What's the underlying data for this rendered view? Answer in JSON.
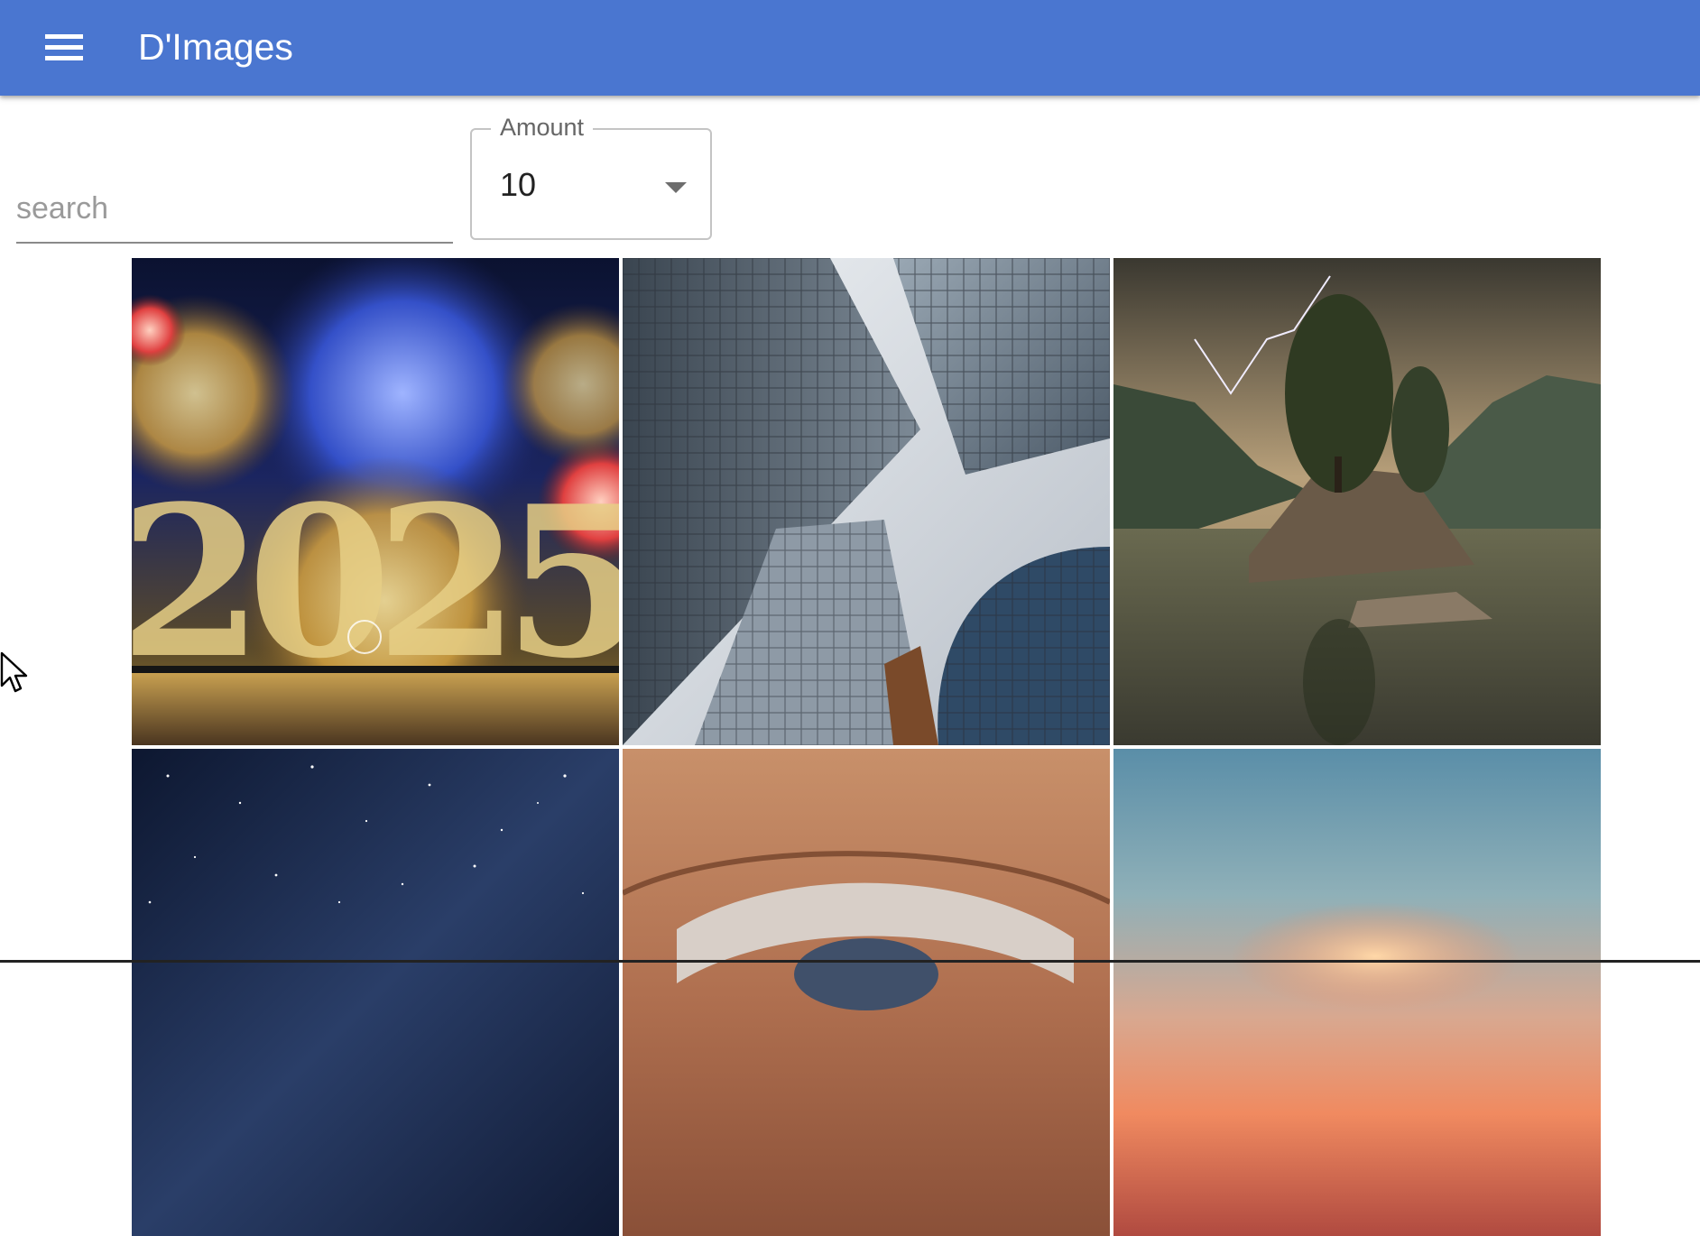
{
  "app": {
    "title": "D'Images",
    "brand_color": "#4a76d0",
    "menu_icon": "hamburger-menu-icon"
  },
  "filters": {
    "search_placeholder": "search",
    "search_value": "",
    "amount_label": "Amount",
    "amount_value": "10"
  },
  "images": [
    {
      "subject": "fireworks-2025"
    },
    {
      "subject": "skyscrapers-looking-up"
    },
    {
      "subject": "lake-trees-lightning"
    },
    {
      "subject": "starry-night-sky"
    },
    {
      "subject": "close-up-eye"
    },
    {
      "subject": "sunset-sky"
    }
  ],
  "overlay_text": {
    "fireworks_year": "2025"
  }
}
